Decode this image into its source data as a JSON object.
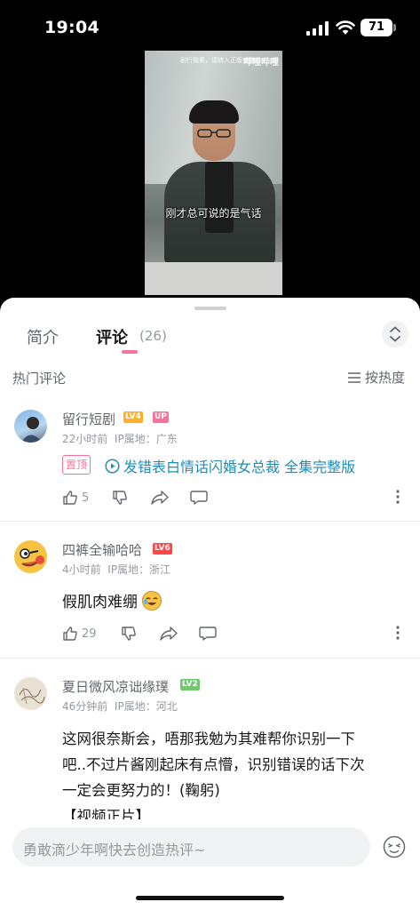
{
  "status": {
    "time": "19:04",
    "battery": "71"
  },
  "video": {
    "watermark": "剧行我素，请转入正版有错",
    "logo": "哔哩哔哩",
    "subtitle": "刚才总可说的是气话"
  },
  "tabs": {
    "intro": "简介",
    "comments": "评论",
    "count": "(26)"
  },
  "section": {
    "hot": "热门评论",
    "sort": "按热度"
  },
  "comments": [
    {
      "name": "留行短剧",
      "level": "LV4",
      "badge": "UP",
      "level_color": "#ffb027",
      "time": "22小时前",
      "ip": "IP属地：广东",
      "pin": "置顶",
      "link": "发错表白情话闪婚女总裁 全集完整版",
      "likes": "5"
    },
    {
      "name": "四裤全输哈哈",
      "level": "LV6",
      "level_color": "#ff4747",
      "time": "4小时前",
      "ip": "IP属地：浙江",
      "text": "假肌肉难绷",
      "likes": "29"
    },
    {
      "name": "夏日微风凉诎缘璞",
      "level": "LV2",
      "level_color": "#73c671",
      "time": "46分钟前",
      "ip": "IP属地：河北",
      "text_lines": [
        "这网很奈斯会，唔那我勉为其难帮你识别一下",
        "吧..不过片酱刚起床有点懵，识别错误的话下次",
        "一定会更努力的！(鞠躬)",
        "【视频正片】"
      ]
    }
  ],
  "input": {
    "placeholder": "勇敢滴少年啊快去创造热评~"
  },
  "colors": {
    "accent": "#fb7299",
    "link": "#1d8eb9",
    "muted": "#9499a0"
  }
}
